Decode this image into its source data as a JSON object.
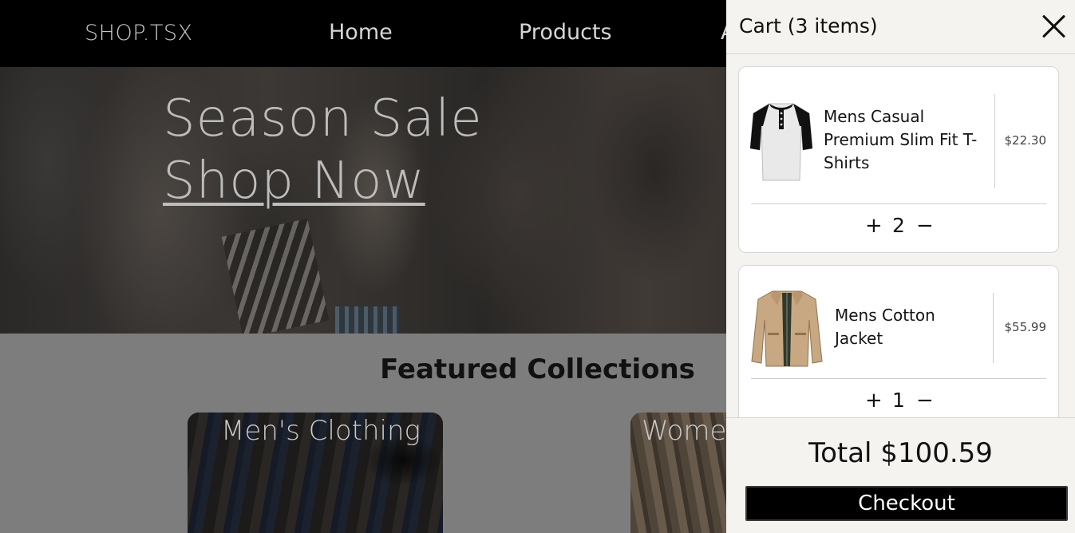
{
  "nav": {
    "logo": "SHOP.TSX",
    "links": [
      "Home",
      "Products",
      "A"
    ]
  },
  "hero": {
    "title": "Season Sale",
    "cta": "Shop Now"
  },
  "featured": {
    "title": "Featured Collections",
    "collections": [
      "Men's Clothing",
      "Wome"
    ]
  },
  "cart": {
    "title": "Cart (3 items)",
    "items": [
      {
        "name": "Mens Casual Premium Slim Fit T-Shirts",
        "price": "$22.30",
        "quantity": "2",
        "image_icon": "henley-tshirt-image"
      },
      {
        "name": "Mens Cotton Jacket",
        "price": "$55.99",
        "quantity": "1",
        "image_icon": "cotton-jacket-image"
      }
    ],
    "total": "Total $100.59",
    "checkout_label": "Checkout",
    "plus_glyph": "+",
    "minus_glyph": "−"
  },
  "colors": {
    "navbar": "#000000",
    "drawer": "#f4f3f0",
    "checkout": "#000000",
    "featured_bg": "#7d7d7d"
  }
}
